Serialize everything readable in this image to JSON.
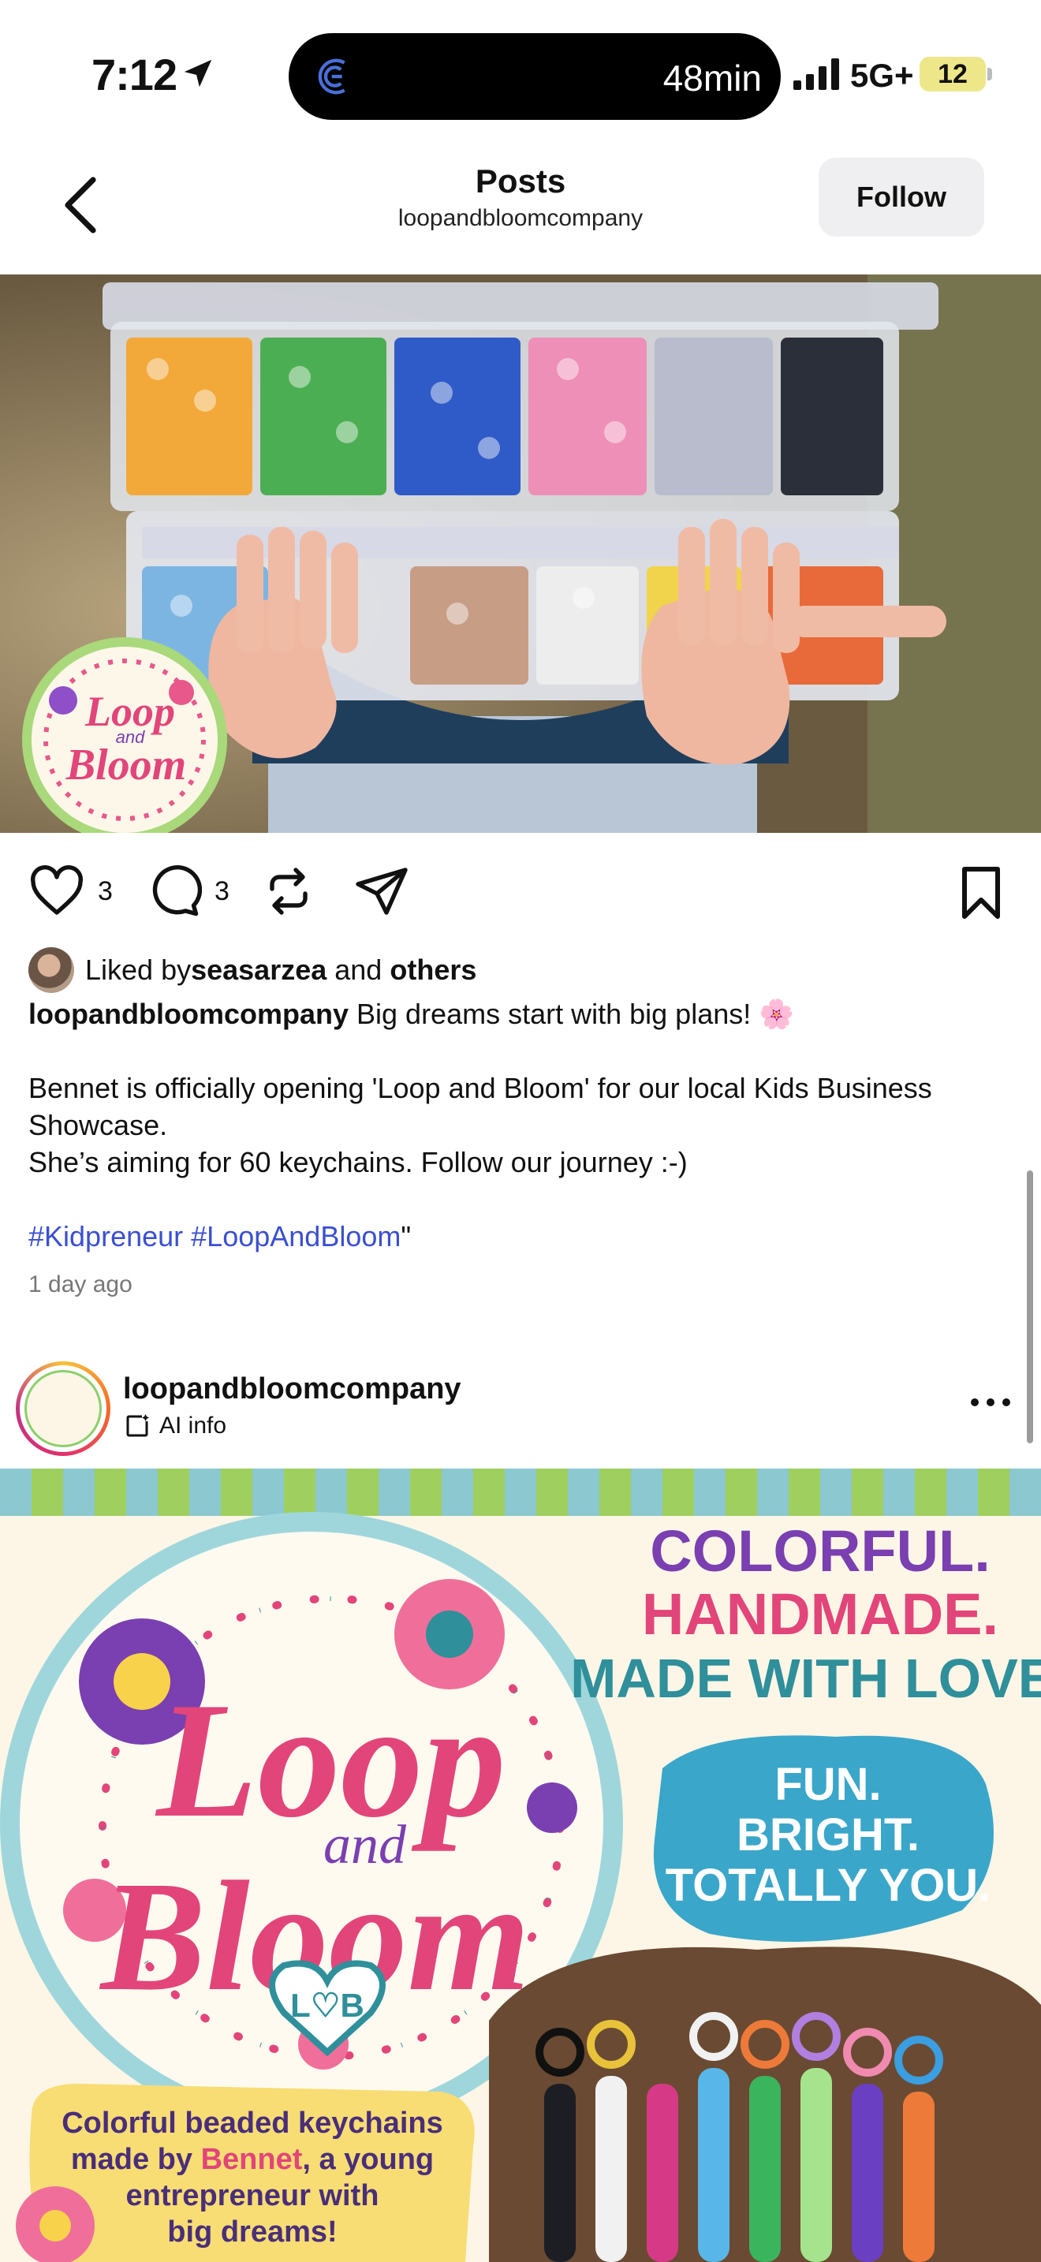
{
  "status_bar": {
    "time": "7:12",
    "live_activity": "48min",
    "network": "5G+",
    "battery": "12"
  },
  "header": {
    "title": "Posts",
    "subtitle": "loopandbloomcompany",
    "follow_label": "Follow"
  },
  "post1": {
    "image_icon": "beads-box-photo",
    "likes_count": "3",
    "comments_count": "3",
    "liked_by_prefix": "Liked by ",
    "liked_by_user": "seasarzea",
    "liked_by_and": " and ",
    "liked_by_others": "others",
    "caption_user": "loopandbloomcompany",
    "caption_line1": " Big dreams start with big plans! 🌸",
    "caption_line2": "Bennet is officially opening 'Loop and Bloom' for our local Kids Business Showcase.",
    "caption_line3": "She’s aiming for 60 keychains. Follow our journey :-)",
    "hashtag1": "#Kidpreneur",
    "hashtag2": "#LoopAndBloom",
    "caption_tail": "\"",
    "time_ago": "1 day ago"
  },
  "post2": {
    "username": "loopandbloomcompany",
    "ai_info": "AI info",
    "flyer": {
      "logo_line1": "Loop",
      "logo_and": "and",
      "logo_line2": "Bloom",
      "logo_monogram": "L♡B",
      "headline1": "COLORFUL.",
      "headline2": "HANDMADE.",
      "headline3": "MADE WITH LOVE.",
      "tagline1": "FUN.",
      "tagline2": "BRIGHT.",
      "tagline3": "TOTALLY YOU.",
      "blurb1": "Colorful beaded keychains",
      "blurb2a": "made by ",
      "blurb2b": "Bennet",
      "blurb2c": ", a young",
      "blurb3": "entrepreneur with",
      "blurb4": "big dreams!"
    }
  },
  "colors": {
    "hashtag": "#3a4fd1",
    "follow_bg": "#efeff1",
    "brand_pink": "#e2457a",
    "brand_teal": "#2f8f9a"
  }
}
